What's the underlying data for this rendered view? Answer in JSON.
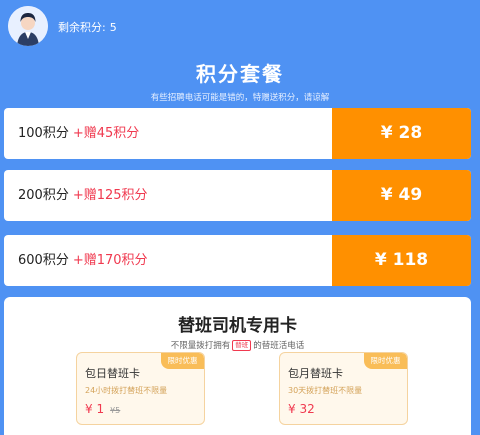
{
  "header": {
    "points_label": "剩余积分:",
    "points_value": "5"
  },
  "title": "积分套餐",
  "subtitle": "有些招聘电话可能是错的，特赠送积分，请谅解",
  "packages": [
    {
      "label": "100积分",
      "bonus": "+赠45积分",
      "price": "¥ 28"
    },
    {
      "label": "200积分",
      "bonus": "+赠125积分",
      "price": "¥ 49"
    },
    {
      "label": "600积分",
      "bonus": "+赠170积分",
      "price": "¥ 118"
    }
  ],
  "driver": {
    "title": "替班司机专用卡",
    "desc_pre": "不限量拨打拥有",
    "desc_tag": "替班",
    "desc_post": "的替班活电话",
    "cards": [
      {
        "tag": "限时优惠",
        "name": "包日替班卡",
        "desc": "24小时拨打替班不限量",
        "price": "¥ 1",
        "old_price": "¥5"
      },
      {
        "tag": "限时优惠",
        "name": "包月替班卡",
        "desc": "30天拨打替班不限量",
        "price": "¥ 32",
        "old_price": ""
      }
    ]
  },
  "colors": {
    "primary_blue": "#4f92f3",
    "price_orange": "#ff9000",
    "bonus_red": "#f0394f",
    "tag_gold": "#f9bd58"
  },
  "icons": {
    "avatar": "user-avatar"
  }
}
